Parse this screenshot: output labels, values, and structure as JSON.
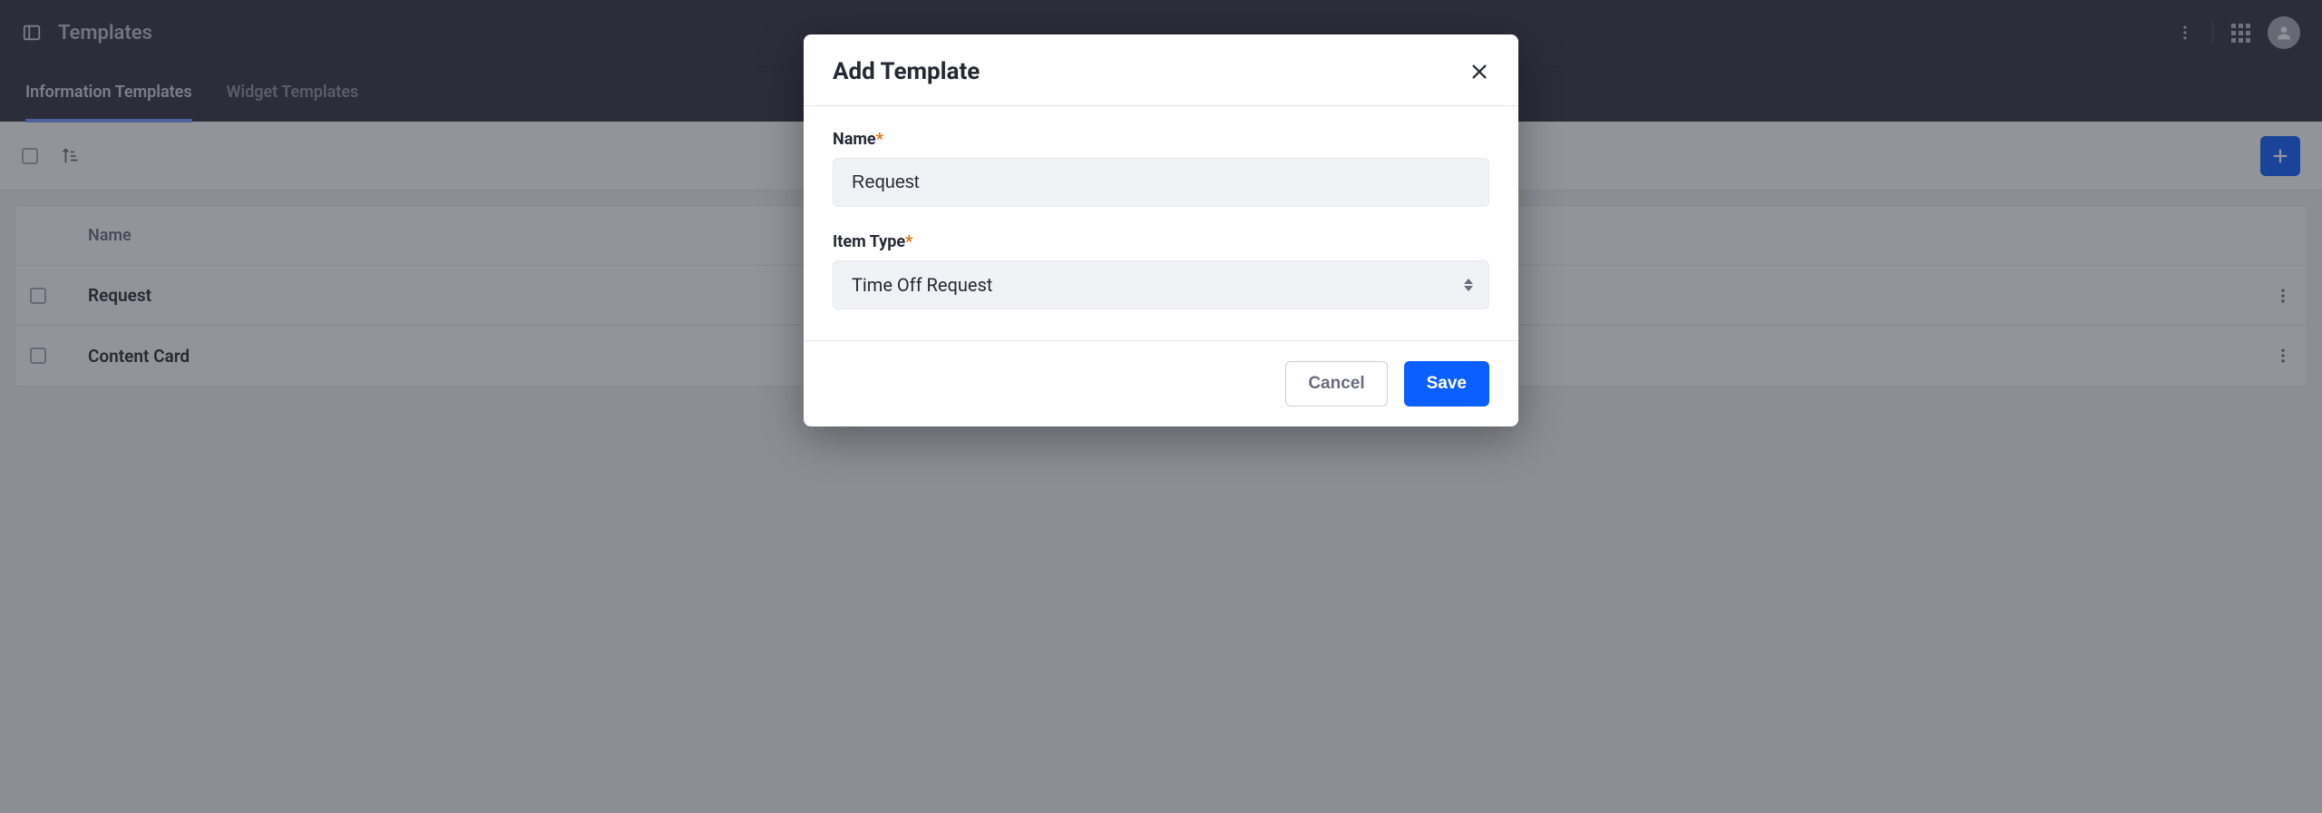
{
  "header": {
    "title": "Templates"
  },
  "tabs": [
    {
      "label": "Information Templates",
      "active": true
    },
    {
      "label": "Widget Templates",
      "active": false
    }
  ],
  "table": {
    "columns": {
      "name": "Name"
    },
    "rows": [
      {
        "name": "Request"
      },
      {
        "name": "Content Card"
      }
    ]
  },
  "modal": {
    "title": "Add Template",
    "fields": {
      "name": {
        "label": "Name",
        "required": true,
        "value": "Request"
      },
      "item_type": {
        "label": "Item Type",
        "required": true,
        "value": "Time Off Request"
      }
    },
    "buttons": {
      "cancel": "Cancel",
      "save": "Save"
    }
  },
  "icons": {
    "panel_toggle": "panel-toggle-icon",
    "kebab": "kebab-icon",
    "apps": "apps-icon",
    "user": "user-icon",
    "sort": "sort-icon",
    "plus": "plus-icon",
    "close": "close-icon",
    "caret": "select-caret-icon"
  },
  "colors": {
    "accent": "#0b5fff",
    "header_bg": "#30313f",
    "required_star": "#d97706"
  }
}
